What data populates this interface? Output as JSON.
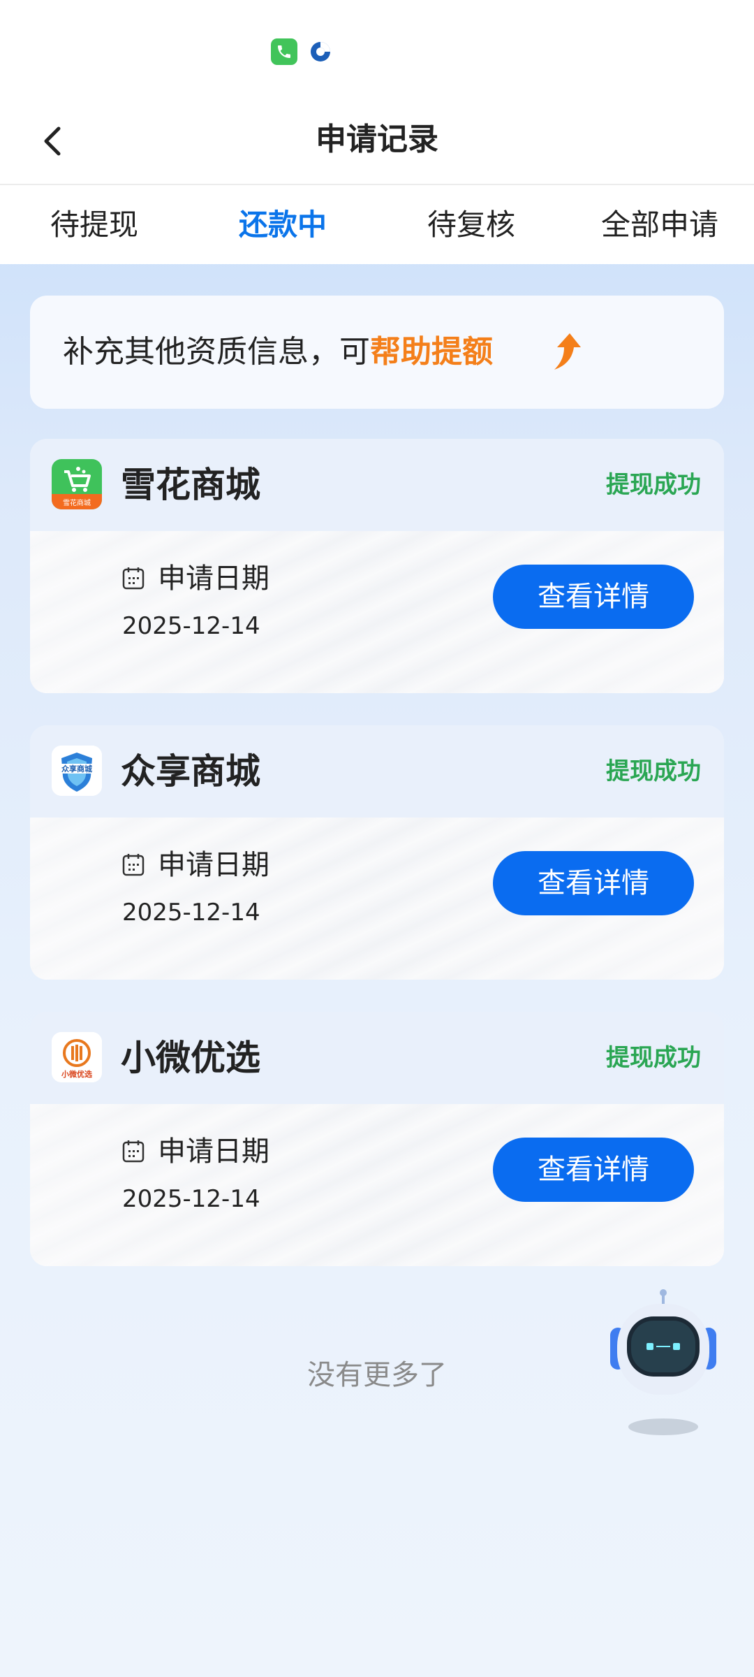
{
  "status_bar": {
    "icons": [
      "phone-app-icon",
      "browser-app-icon"
    ]
  },
  "nav": {
    "back_icon": "chevron-left-icon",
    "title": "申请记录"
  },
  "tabs": [
    {
      "label": "待提现",
      "active": false
    },
    {
      "label": "还款中",
      "active": true
    },
    {
      "label": "待复核",
      "active": false
    },
    {
      "label": "全部申请",
      "active": false
    }
  ],
  "banner": {
    "text": "补充其他资质信息，可",
    "highlight": "帮助提额",
    "icon": "arrow-up-icon",
    "highlight_color": "#f47f1a"
  },
  "records": [
    {
      "name": "雪花商城",
      "status": "提现成功",
      "date_label": "申请日期",
      "date": "2025-12-14",
      "button": "查看详情",
      "logo_icon": "snowflake-mall-logo",
      "logo_text": "雪花商城"
    },
    {
      "name": "众享商城",
      "status": "提现成功",
      "date_label": "申请日期",
      "date": "2025-12-14",
      "button": "查看详情",
      "logo_icon": "zhongxiang-mall-logo",
      "logo_text": "众享商城"
    },
    {
      "name": "小微优选",
      "status": "提现成功",
      "date_label": "申请日期",
      "date": "2025-12-14",
      "button": "查看详情",
      "logo_icon": "xiaowei-select-logo",
      "logo_text": "小微优选"
    }
  ],
  "footer": {
    "no_more": "没有更多了"
  },
  "assistant": {
    "icon": "robot-assistant-icon"
  },
  "colors": {
    "primary": "#0a6cf0",
    "active_tab": "#0a74ea",
    "success": "#2aa653",
    "accent": "#f47f1a"
  }
}
